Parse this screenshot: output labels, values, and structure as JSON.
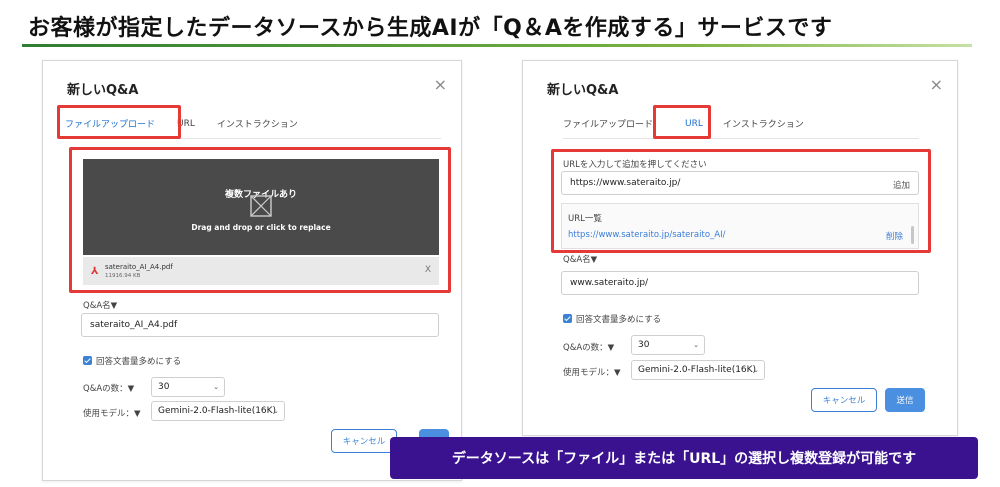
{
  "headline": "お客様が指定したデータソースから生成AIが「Q＆Aを作成する」サービスです",
  "banner": "データソースは「ファイル」または「URL」の選択し複数登録が可能です",
  "left": {
    "title": "新しいQ&A",
    "close": "×",
    "tabs": [
      "ファイルアップロード",
      "URL",
      "インストラクション"
    ],
    "active_tab": 0,
    "dropzone": {
      "title": "複数ファイルあり",
      "hint": "Drag and drop or click to replace"
    },
    "file": {
      "name": "sateraito_AI_A4.pdf",
      "size": "11916.94 KB",
      "remove": "X",
      "icon": "pdf-icon"
    },
    "qa_name_label": "Q&A名▼",
    "qa_name_value": "sateraito_AI_A4.pdf",
    "checkbox_label": "回答文書量多めにする",
    "count_label": "Q&Aの数：▼",
    "count_value": "30",
    "model_label": "使用モデル：▼",
    "model_value": "Gemini-2.0-Flash-lite(16K)",
    "cancel": "キャンセル"
  },
  "right": {
    "title": "新しいQ&A",
    "close": "×",
    "tabs": [
      "ファイルアップロード",
      "URL",
      "インストラクション"
    ],
    "active_tab": 1,
    "url_prompt": "URLを入力して追加を押してください",
    "url_input": "https://www.sateraito.jp/",
    "add": "追加",
    "url_list_label": "URL一覧",
    "url_list": [
      {
        "url": "https://www.sateraito.jp/sateraito_AI/",
        "delete": "削除"
      }
    ],
    "qa_name_label": "Q&A名▼",
    "qa_name_value": "www.sateraito.jp/",
    "checkbox_label": "回答文書量多めにする",
    "count_label": "Q&Aの数：▼",
    "count_value": "30",
    "model_label": "使用モデル：▼",
    "model_value": "Gemini-2.0-Flash-lite(16K)",
    "cancel": "キャンセル",
    "send": "送信"
  },
  "colors": {
    "accent": "#3b82d6",
    "highlight": "#e53935",
    "banner": "#3a1290",
    "rule": "#2e7d32"
  }
}
